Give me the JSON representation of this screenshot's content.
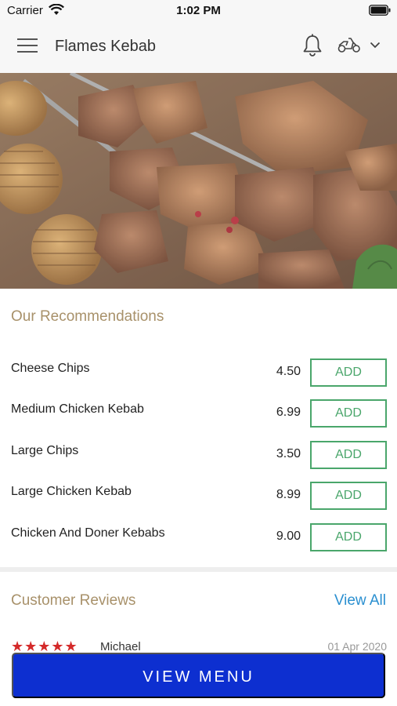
{
  "status_bar": {
    "carrier": "Carrier",
    "time": "1:02 PM"
  },
  "header": {
    "title": "Flames Kebab",
    "icons": [
      "menu-icon",
      "bell-icon",
      "scooter-icon",
      "chevron-down-icon"
    ]
  },
  "hero": {
    "description_icon": "kebab-photo"
  },
  "recommendations": {
    "title": "Our Recommendations",
    "add_label": "ADD",
    "items": [
      {
        "name": "Cheese Chips",
        "price": "4.50"
      },
      {
        "name": "Medium Chicken Kebab",
        "price": "6.99"
      },
      {
        "name": "Large Chips",
        "price": "3.50"
      },
      {
        "name": "Large Chicken Kebab",
        "price": "8.99"
      },
      {
        "name": "Chicken And Doner Kebabs",
        "price": "9.00"
      }
    ]
  },
  "reviews": {
    "title": "Customer Reviews",
    "view_all": "View All",
    "first": {
      "stars": "★★★★★",
      "name": "Michael",
      "date": "01 Apr 2020"
    }
  },
  "footer": {
    "button_label": "VIEW MENU"
  },
  "colors": {
    "accent_gold": "#a8916a",
    "add_green": "#4aa66b",
    "link_blue": "#2a8fd0",
    "primary_blue": "#0d2fd0",
    "star_red": "#d42a2a"
  }
}
